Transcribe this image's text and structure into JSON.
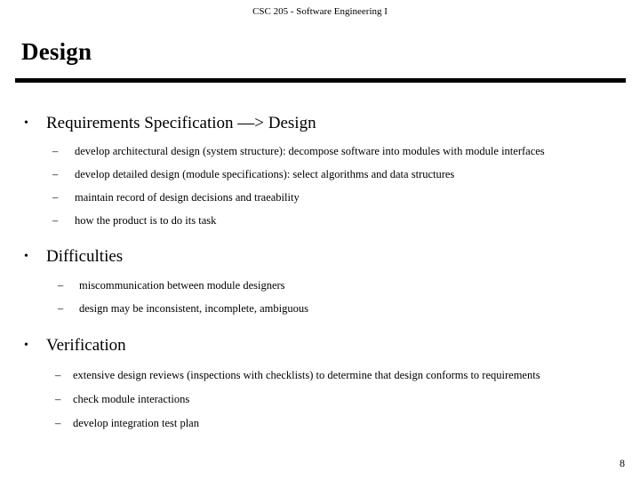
{
  "header": {
    "course_line": "CSC 205 - Software Engineering I"
  },
  "title": "Design",
  "sections": [
    {
      "heading": "Requirements Specification —> Design",
      "bullet_marker": "•",
      "sub_marker": "–",
      "sub_items": [
        "develop architectural design (system structure): decompose software into modules with module interfaces",
        "develop detailed design (module specifications): select algorithms and data structures",
        "maintain record of design decisions and traeability",
        "how  the product is to do its task"
      ]
    },
    {
      "heading": "Difficulties",
      "bullet_marker": "•",
      "sub_marker": "–",
      "sub_items": [
        "miscommunication between module designers",
        "design may be inconsistent, incomplete, ambiguous"
      ]
    },
    {
      "heading": "Verification",
      "bullet_marker": "•",
      "sub_marker": "–",
      "sub_items": [
        "extensive design reviews (inspections with checklists) to determine that design conforms to requirements",
        "check module interactions",
        "develop integration test plan"
      ]
    }
  ],
  "footer": {
    "page_number": "8"
  }
}
